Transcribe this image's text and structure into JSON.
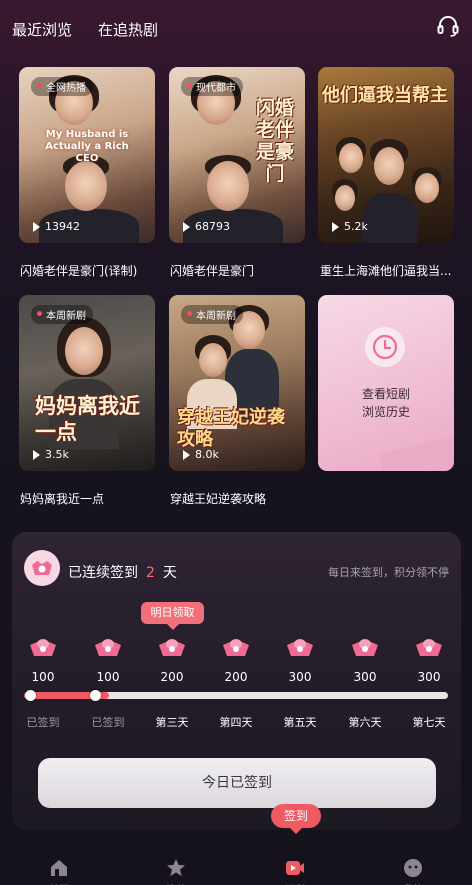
{
  "header": {
    "tabs": [
      "最近浏览",
      "在追热剧"
    ],
    "support_icon": "headset-icon"
  },
  "dramas": [
    {
      "badge": "全网热播",
      "english_title": "My Husband is Actually a Rich CEO",
      "plays": "13942",
      "title": "闪婚老伴是豪门(译制)"
    },
    {
      "badge": "现代都市",
      "poster_title": "闪婚老伴是豪门",
      "plays": "68793",
      "title": "闪婚老伴是豪门"
    },
    {
      "badge": "",
      "poster_title": "他们逼我当帮主",
      "plays": "5.2k",
      "title": "重生上海滩他们逼我当..."
    },
    {
      "badge": "本周新剧",
      "poster_title": "妈妈离我近一点",
      "plays": "3.5k",
      "title": "妈妈离我近一点"
    },
    {
      "badge": "本周新剧",
      "poster_title": "穿越王妃逆袭攻略",
      "plays": "8.0k",
      "title": "穿越王妃逆袭攻略"
    }
  ],
  "history_card": {
    "line1": "查看短剧",
    "line2": "浏览历史",
    "icon": "clock-history-icon"
  },
  "checkin": {
    "streak_prefix": "已连续签到",
    "streak_days": "2",
    "streak_suffix": "天",
    "hint": "每日来签到，积分领不停",
    "tomorrow_tip": "明日领取",
    "progress_fraction": 0.2,
    "points": [
      "100",
      "100",
      "200",
      "200",
      "300",
      "300",
      "300"
    ],
    "days": [
      "已签到",
      "已签到",
      "第三天",
      "第四天",
      "第五天",
      "第六天",
      "第七天"
    ],
    "button_label": "今日已签到",
    "accent_color": "#ef5a63"
  },
  "bottom_nav": {
    "items": [
      {
        "icon": "home-icon",
        "label": "首页"
      },
      {
        "icon": "star-icon",
        "label": "推荐"
      },
      {
        "icon": "video-icon",
        "label": "福利"
      },
      {
        "icon": "profile-icon",
        "label": "我的"
      }
    ],
    "sign_pill": "签到"
  }
}
